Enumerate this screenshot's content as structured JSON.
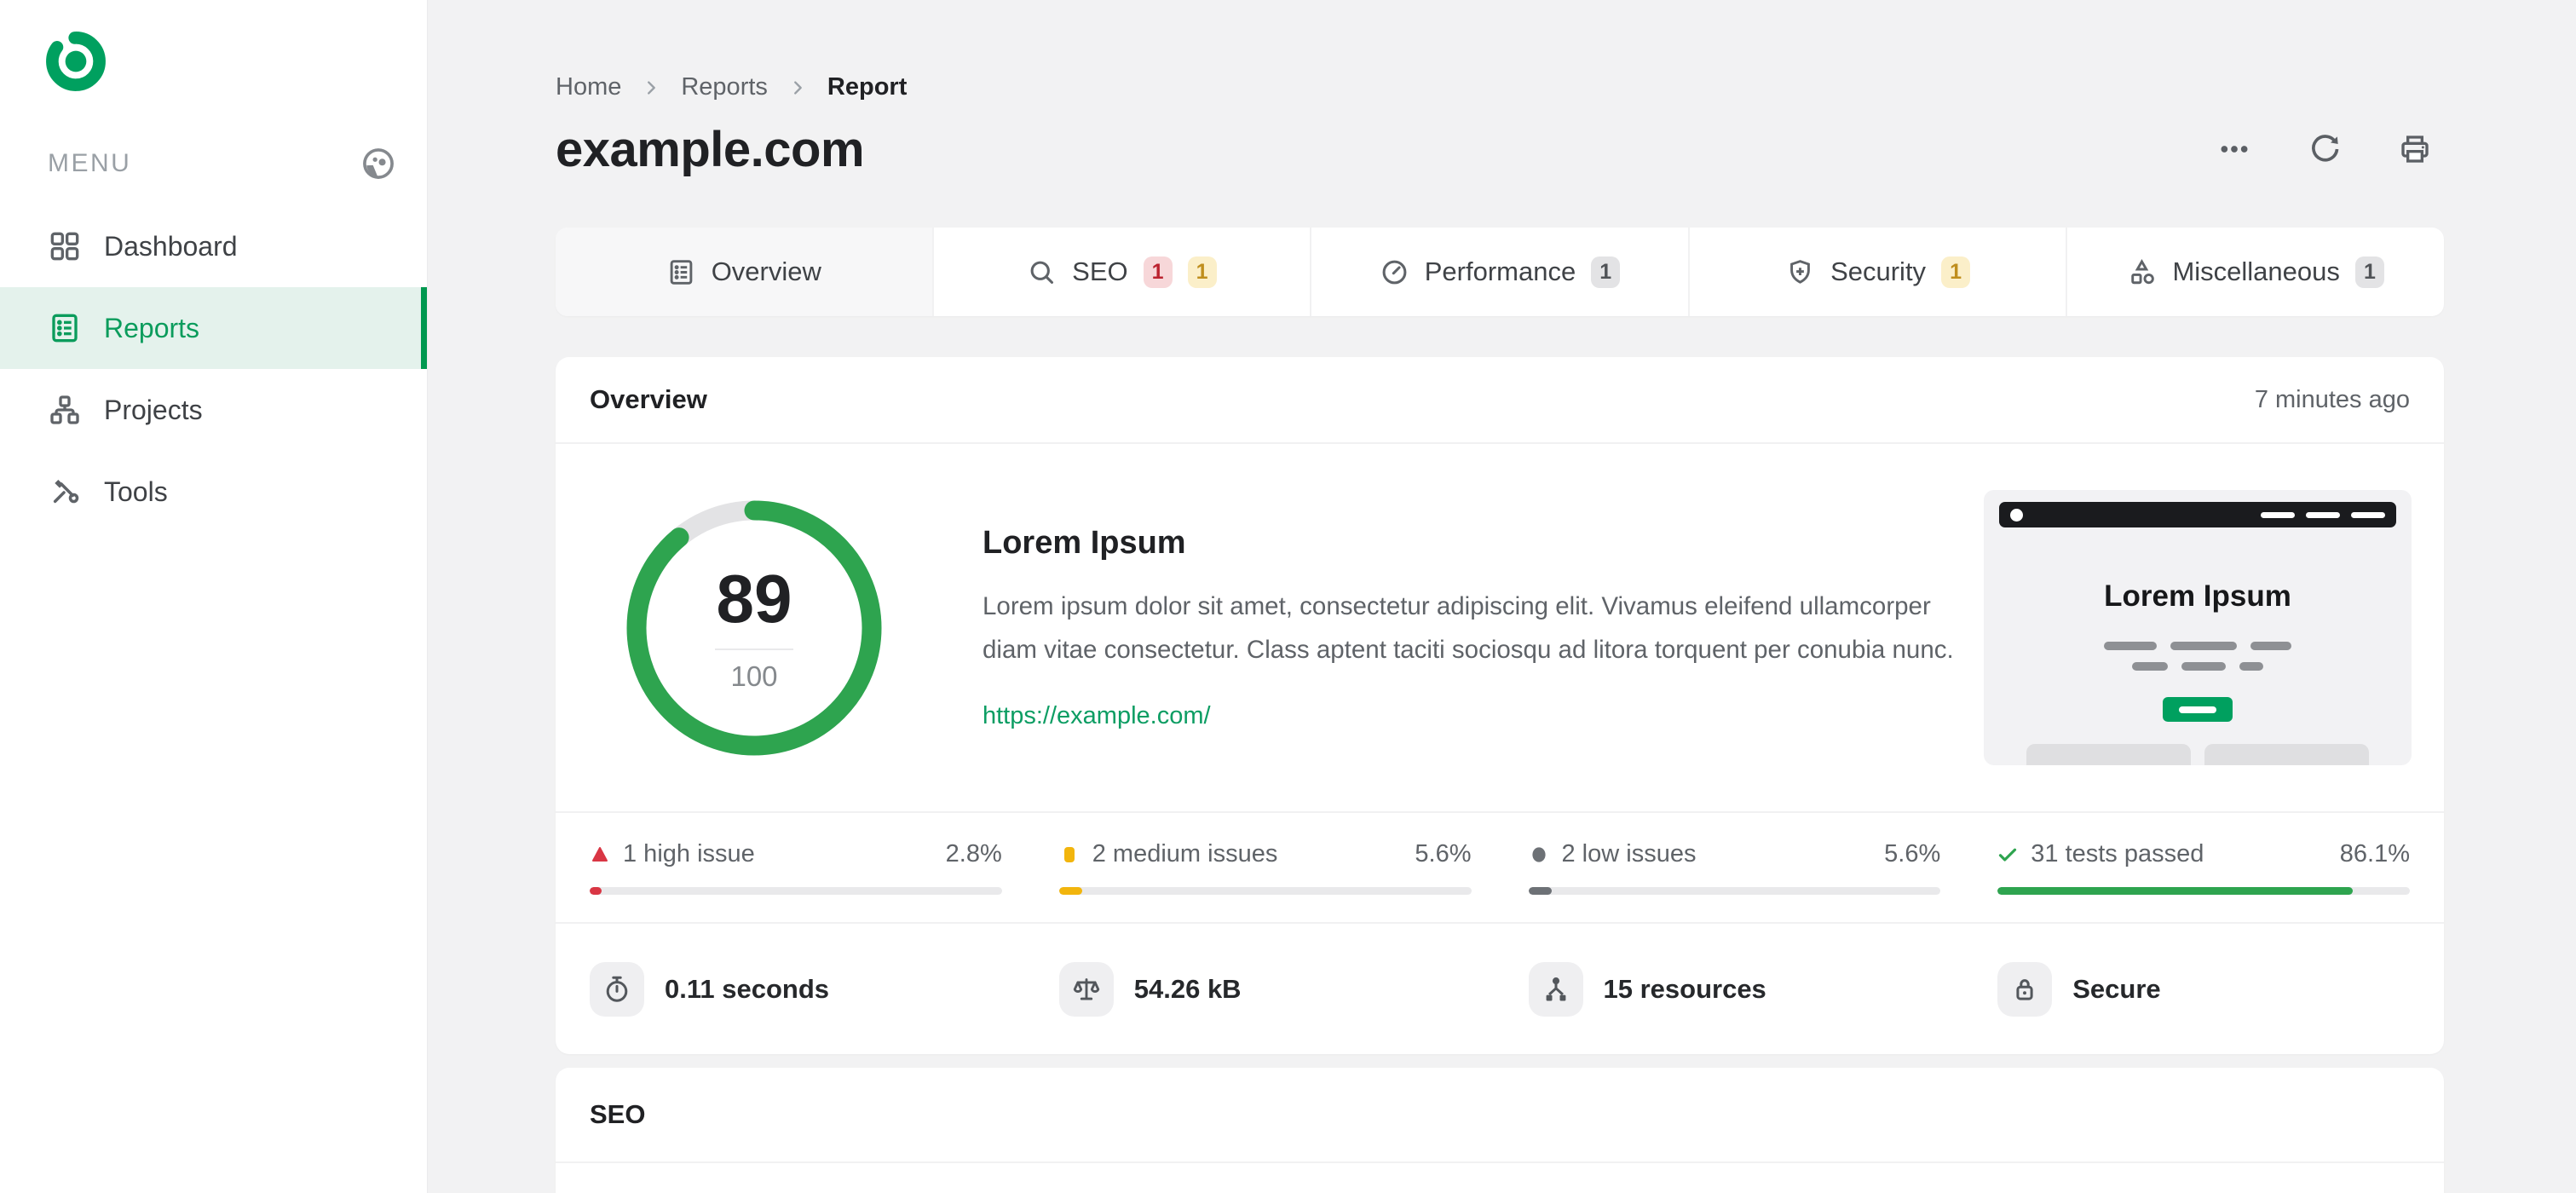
{
  "colors": {
    "brand_green": "#00a05f",
    "active_nav_bg": "#e4f2ec",
    "ring_green": "#2ea44f",
    "link_green": "#0c9d63",
    "issue_high": "#d93644",
    "issue_medium": "#f2b50d",
    "issue_low": "#6d7176",
    "passed_green": "#2ea44f",
    "badge_high_bg": "#f7d7d9",
    "badge_medium_bg": "#fbefc9",
    "badge_neutral_bg": "#e3e3e5",
    "page_bg": "#f2f2f3"
  },
  "icons": {
    "logo-icon": "◎",
    "theme-toggle-icon": "◐",
    "dashboard-icon": "▦",
    "reports-icon": "☷",
    "projects-icon": "⌥",
    "tools-icon": "⚒",
    "breadcrumb-chevron-icon": "›",
    "more-options-icon": "⋯",
    "refresh-icon": "⟳",
    "print-icon": "🖨",
    "overview-tab-icon": "☰",
    "search-icon": "🔍",
    "performance-icon": "⏱",
    "security-shield-icon": "🛡",
    "miscellaneous-shapes-icon": "△▢◯",
    "high-issue-icon": "▲",
    "medium-issue-icon": "▮",
    "low-issue-icon": "●",
    "passed-check-icon": "✓",
    "stopwatch-icon": "⏱",
    "scale-icon": "⚖",
    "resources-icon": "⚇",
    "lock-icon": "🔒"
  },
  "sidebar": {
    "menu_label": "MENU",
    "items": [
      {
        "label": "Dashboard",
        "active": false
      },
      {
        "label": "Reports",
        "active": true
      },
      {
        "label": "Projects",
        "active": false
      },
      {
        "label": "Tools",
        "active": false
      }
    ]
  },
  "header": {
    "breadcrumb": [
      "Home",
      "Reports",
      "Report"
    ],
    "title": "example.com"
  },
  "tabs": [
    {
      "label": "Overview",
      "active": true,
      "badges": []
    },
    {
      "label": "SEO",
      "active": false,
      "badges": [
        {
          "value": "1",
          "type": "high"
        },
        {
          "value": "1",
          "type": "medium"
        }
      ]
    },
    {
      "label": "Performance",
      "active": false,
      "badges": [
        {
          "value": "1",
          "type": "neutral"
        }
      ]
    },
    {
      "label": "Security",
      "active": false,
      "badges": [
        {
          "value": "1",
          "type": "medium"
        }
      ]
    },
    {
      "label": "Miscellaneous",
      "active": false,
      "badges": [
        {
          "value": "1",
          "type": "neutral"
        }
      ]
    }
  ],
  "overview": {
    "section_title": "Overview",
    "updated": "7 minutes ago",
    "score": {
      "value": 89,
      "max": 100
    },
    "site": {
      "heading": "Lorem Ipsum",
      "description": "Lorem ipsum dolor sit amet, consectetur adipiscing elit. Vivamus eleifend ullamcorper diam vitae consectetur. Class aptent taciti sociosqu ad litora torquent per conubia nunc.",
      "url": "https://example.com/"
    },
    "preview": {
      "heading": "Lorem Ipsum"
    },
    "issues": [
      {
        "label": "1 high issue",
        "percent": "2.8%",
        "value": 2.8,
        "type": "high"
      },
      {
        "label": "2 medium issues",
        "percent": "5.6%",
        "value": 5.6,
        "type": "medium"
      },
      {
        "label": "2 low issues",
        "percent": "5.6%",
        "value": 5.6,
        "type": "low"
      },
      {
        "label": "31 tests passed",
        "percent": "86.1%",
        "value": 86.1,
        "type": "passed"
      }
    ],
    "metrics": [
      {
        "label": "0.11 seconds",
        "icon": "stopwatch-icon"
      },
      {
        "label": "54.26 kB",
        "icon": "scale-icon"
      },
      {
        "label": "15 resources",
        "icon": "resources-icon"
      },
      {
        "label": "Secure",
        "icon": "lock-icon"
      }
    ]
  },
  "seo_section": {
    "title": "SEO"
  }
}
